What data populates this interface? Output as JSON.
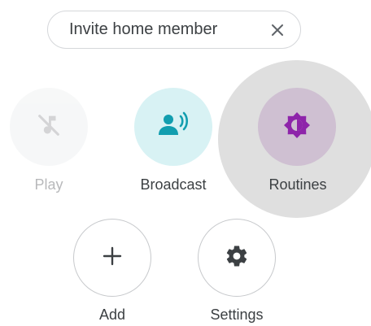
{
  "invite_chip": {
    "label": "Invite home member",
    "close_icon": "close-icon"
  },
  "actions": [
    {
      "label": "Play",
      "icon": "music-off-icon",
      "enabled": false
    },
    {
      "label": "Broadcast",
      "icon": "broadcast-icon",
      "enabled": true
    },
    {
      "label": "Routines",
      "icon": "routines-icon",
      "enabled": true,
      "pressed": true
    },
    {
      "label": "Add",
      "icon": "plus-icon",
      "enabled": true
    },
    {
      "label": "Settings",
      "icon": "gear-icon",
      "enabled": true
    }
  ],
  "colors": {
    "broadcast_bg": "#d8f2f4",
    "broadcast_icon": "#129eaf",
    "routines_bg": "#cfc0d2",
    "routines_icon": "#8e24aa",
    "play_icon": "#b8b9bb",
    "text": "#3c4043",
    "disabled_text": "#b8b9bb"
  }
}
